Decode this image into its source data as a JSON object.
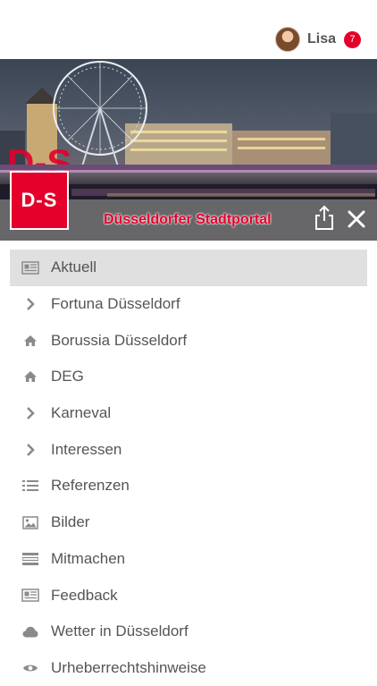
{
  "user": {
    "name": "Lisa",
    "notification_count": "7"
  },
  "banner": {
    "logo_text": "D-S",
    "title": "Düsseldorfer Stadtportal"
  },
  "colors": {
    "accent": "#e4002b",
    "menu_text": "#555555",
    "active_row": "#e0e0e0",
    "icon": "#8a8a8a"
  },
  "menu": [
    {
      "label": "Aktuell",
      "icon": "newspaper-icon",
      "active": true
    },
    {
      "label": "Fortuna Düsseldorf",
      "icon": "chevron-right-icon"
    },
    {
      "label": "Borussia Düsseldorf",
      "icon": "home-icon"
    },
    {
      "label": "DEG",
      "icon": "home-icon"
    },
    {
      "label": "Karneval",
      "icon": "chevron-right-icon"
    },
    {
      "label": "Interessen",
      "icon": "chevron-right-icon"
    },
    {
      "label": "Referenzen",
      "icon": "list-icon"
    },
    {
      "label": "Bilder",
      "icon": "image-icon"
    },
    {
      "label": "Mitmachen",
      "icon": "form-icon"
    },
    {
      "label": "Feedback",
      "icon": "newspaper-icon"
    },
    {
      "label": "Wetter in Düsseldorf",
      "icon": "cloud-icon"
    },
    {
      "label": "Urheberrechtshinweise",
      "icon": "eye-icon"
    }
  ]
}
